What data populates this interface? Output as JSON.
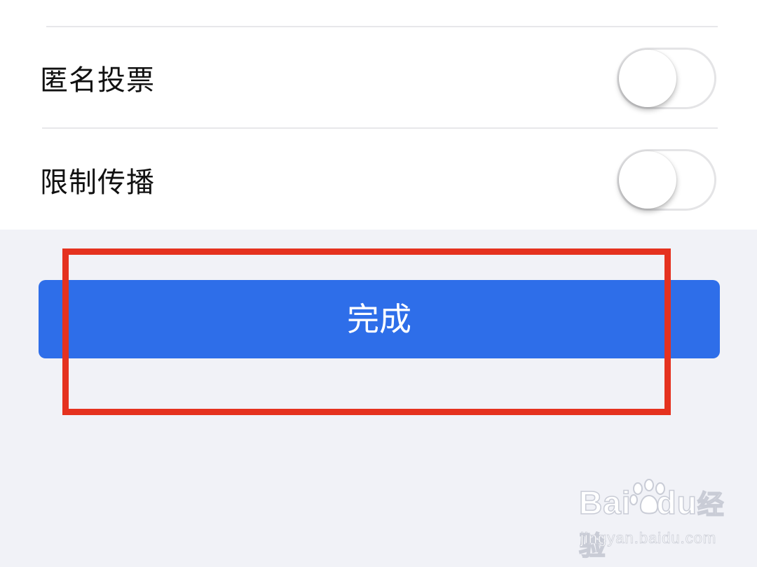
{
  "settings": {
    "rows": [
      {
        "label": "匿名投票",
        "toggle_on": false
      },
      {
        "label": "限制传播",
        "toggle_on": false
      }
    ]
  },
  "actions": {
    "done_label": "完成"
  },
  "annotation": {
    "highlight_color": "#e5321f"
  },
  "watermark": {
    "logo_text": "Bai",
    "logo_text_tail": "du",
    "logo_cn": "经验",
    "url": "jingyan.baidu.com"
  },
  "colors": {
    "accent": "#2e6ee9",
    "background": "#f1f2f7",
    "panel": "#ffffff"
  }
}
